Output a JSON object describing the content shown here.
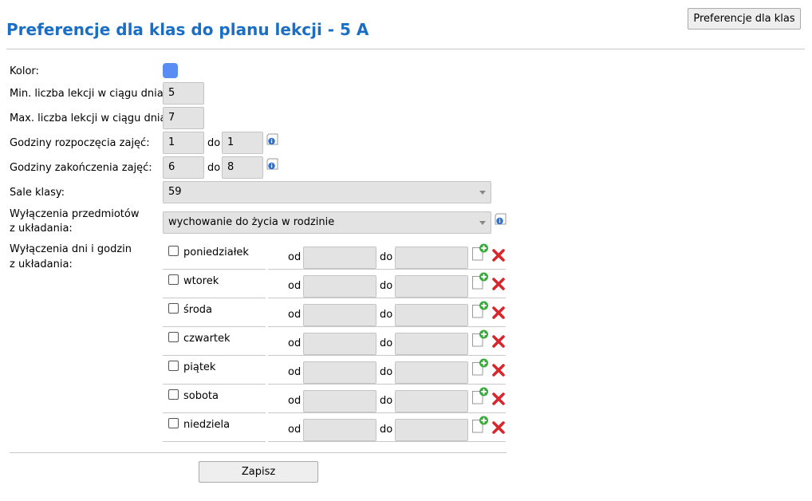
{
  "header": {
    "title": "Preferencje dla klas do planu lekcji - 5 A",
    "top_button": "Preferencje dla klas"
  },
  "form": {
    "color_label": "Kolor:",
    "color_value": "#5a8df4",
    "min_label": "Min. liczba lekcji w ciągu dnia:",
    "min_value": "5",
    "max_label": "Max. liczba lekcji w ciągu dnia:",
    "max_value": "7",
    "start_label": "Godziny rozpoczęcia zajęć:",
    "start_from": "1",
    "start_to": "1",
    "end_label": "Godziny zakończenia zajęć:",
    "end_from": "6",
    "end_to": "8",
    "range_sep": "do",
    "rooms_label": "Sale klasy:",
    "rooms_value": "59",
    "subj_excl_label_1": "Wyłączenia przedmiotów",
    "subj_excl_label_2": "z układania:",
    "subj_excl_value": "wychowanie do życia w rodzinie",
    "days_excl_label_1": "Wyłączenia dni i godzin",
    "days_excl_label_2": "z układania:",
    "from_label": "od",
    "to_label": "do",
    "days": [
      "poniedziałek",
      "wtorek",
      "środa",
      "czwartek",
      "piątek",
      "sobota",
      "niedziela"
    ]
  },
  "footer": {
    "save_label": "Zapisz"
  },
  "icons": {
    "info": "info-icon",
    "add": "add-icon",
    "delete": "delete-icon"
  }
}
